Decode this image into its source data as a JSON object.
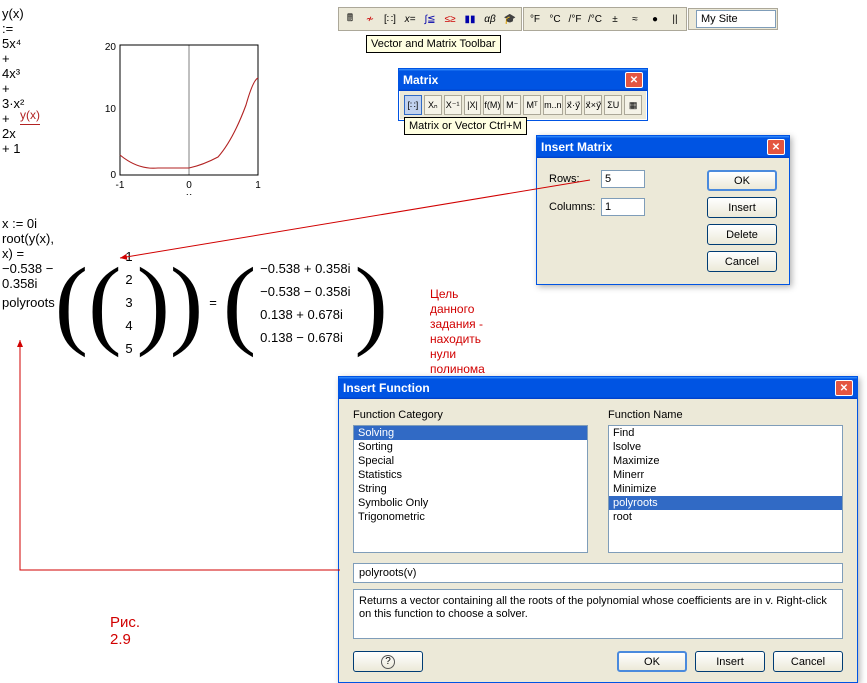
{
  "toolbar": {
    "tooltip1": "Vector and Matrix Toolbar",
    "tooltip2": "Matrix or Vector Ctrl+M",
    "site_value": "My Site",
    "unit_btns": [
      "°F",
      "°C",
      "/°F",
      "/°C",
      "±",
      "≈",
      "●",
      "||"
    ]
  },
  "math": {
    "formula_y": "y(x) := 5x⁴ + 4x³ + 3·x² + 2x + 1",
    "legend": "y(x)",
    "formula_root": "x := 0i    root(y(x), x) = −0.538 − 0.358i",
    "polyroots_fn": "polyroots",
    "input_vector": [
      "1",
      "2",
      "3",
      "4",
      "5"
    ],
    "output_vector": [
      "−0.538 + 0.358i",
      "−0.538 − 0.358i",
      "0.138 + 0.678i",
      "0.138 − 0.678i"
    ],
    "annotation": "Цель данного задания - находить нули полинома и, заодно,\nнаучиться вводить в расчет вектора и матрицы",
    "caption": "Рис. 2.9"
  },
  "matrix_palette": {
    "title": "Matrix",
    "btns": [
      "[∷]",
      "Xₙ",
      "X⁻¹",
      "|X|",
      "f(M)",
      "M⁻",
      "Mᵀ",
      "m..n",
      "x⃗·y⃗",
      "x⃗×y⃗",
      "ΣU",
      "▦"
    ]
  },
  "insert_matrix": {
    "title": "Insert Matrix",
    "rows_label": "Rows:",
    "rows_value": "5",
    "cols_label": "Columns:",
    "cols_value": "1",
    "btn_ok": "OK",
    "btn_insert": "Insert",
    "btn_delete": "Delete",
    "btn_cancel": "Cancel"
  },
  "insert_fn": {
    "title": "Insert Function",
    "cat_header": "Function Category",
    "name_header": "Function Name",
    "categories": [
      "Solving",
      "Sorting",
      "Special",
      "Statistics",
      "String",
      "Symbolic Only",
      "Trigonometric"
    ],
    "cat_selected": "Solving",
    "names": [
      "Find",
      "lsolve",
      "Maximize",
      "Minerr",
      "Minimize",
      "polyroots",
      "root"
    ],
    "name_selected": "polyroots",
    "signature": "polyroots(v)",
    "description": "Returns a vector containing all the roots of the polynomial whose coefficients are in v. Right-click on this function to choose a solver.",
    "btn_ok": "OK",
    "btn_insert": "Insert",
    "btn_cancel": "Cancel",
    "btn_help": "?"
  },
  "chart_data": {
    "type": "line",
    "title": "",
    "xlabel": "x",
    "ylabel": "",
    "xlim": [
      -1,
      1
    ],
    "ylim": [
      0,
      20
    ],
    "x_ticks": [
      -1,
      0,
      1
    ],
    "y_ticks": [
      0,
      10,
      20
    ],
    "series": [
      {
        "name": "y(x)",
        "color": "#b22222",
        "x": [
          -1.0,
          -0.8,
          -0.6,
          -0.4,
          -0.2,
          0.0,
          0.2,
          0.4,
          0.6,
          0.8,
          1.0
        ],
        "values": [
          3.0,
          1.4,
          1.0,
          1.0,
          1.1,
          1.0,
          1.5,
          2.8,
          5.5,
          9.9,
          15.0
        ]
      }
    ]
  }
}
